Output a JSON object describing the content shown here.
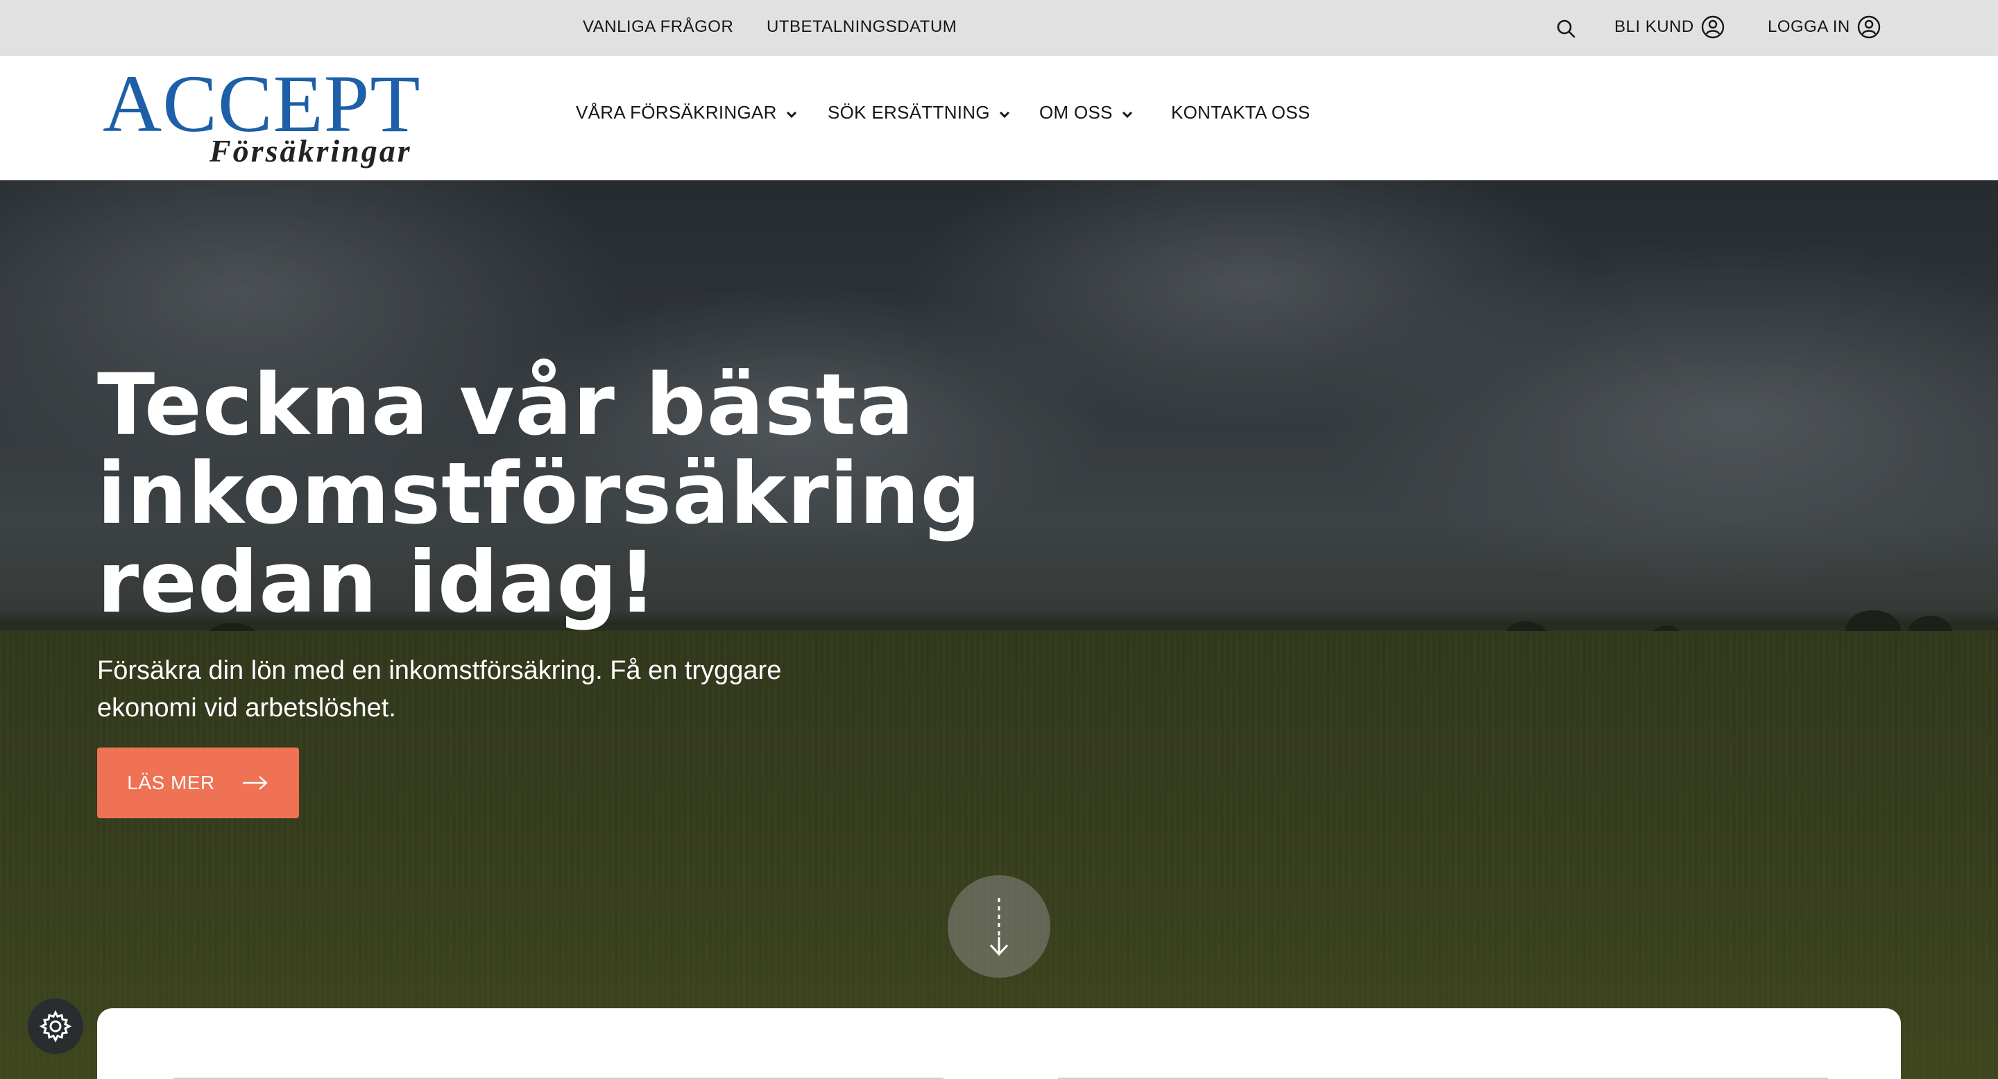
{
  "topbar": {
    "links": [
      "VANLIGA FRÅGOR",
      "UTBETALNINGSDATUM"
    ],
    "bli_kund": "BLI KUND",
    "logga_in": "LOGGA IN",
    "icons": [
      "search-icon",
      "user-circle-icon"
    ]
  },
  "logo": {
    "brand": "ACCEPT",
    "sub": "Försäkringar",
    "brand_color": "#1d5fa8"
  },
  "nav": {
    "items": [
      {
        "label": "VÅRA FÖRSÄKRINGAR",
        "dropdown": true
      },
      {
        "label": "SÖK ERSÄTTNING",
        "dropdown": true
      },
      {
        "label": "OM OSS",
        "dropdown": true
      },
      {
        "label": "KONTAKTA OSS",
        "dropdown": false
      }
    ]
  },
  "hero": {
    "title": "Teckna vår bästa inkomstförsäkring redan idag!",
    "lead": "Försäkra din lön med en inkomstförsäkring. Få en tryggare ekonomi vid arbetslöshet.",
    "cta_label": "LÄS MER",
    "cta_color": "#ee7253",
    "scroll_icon": "arrow-down-icon"
  },
  "cookie": {
    "icon": "gear-icon"
  }
}
